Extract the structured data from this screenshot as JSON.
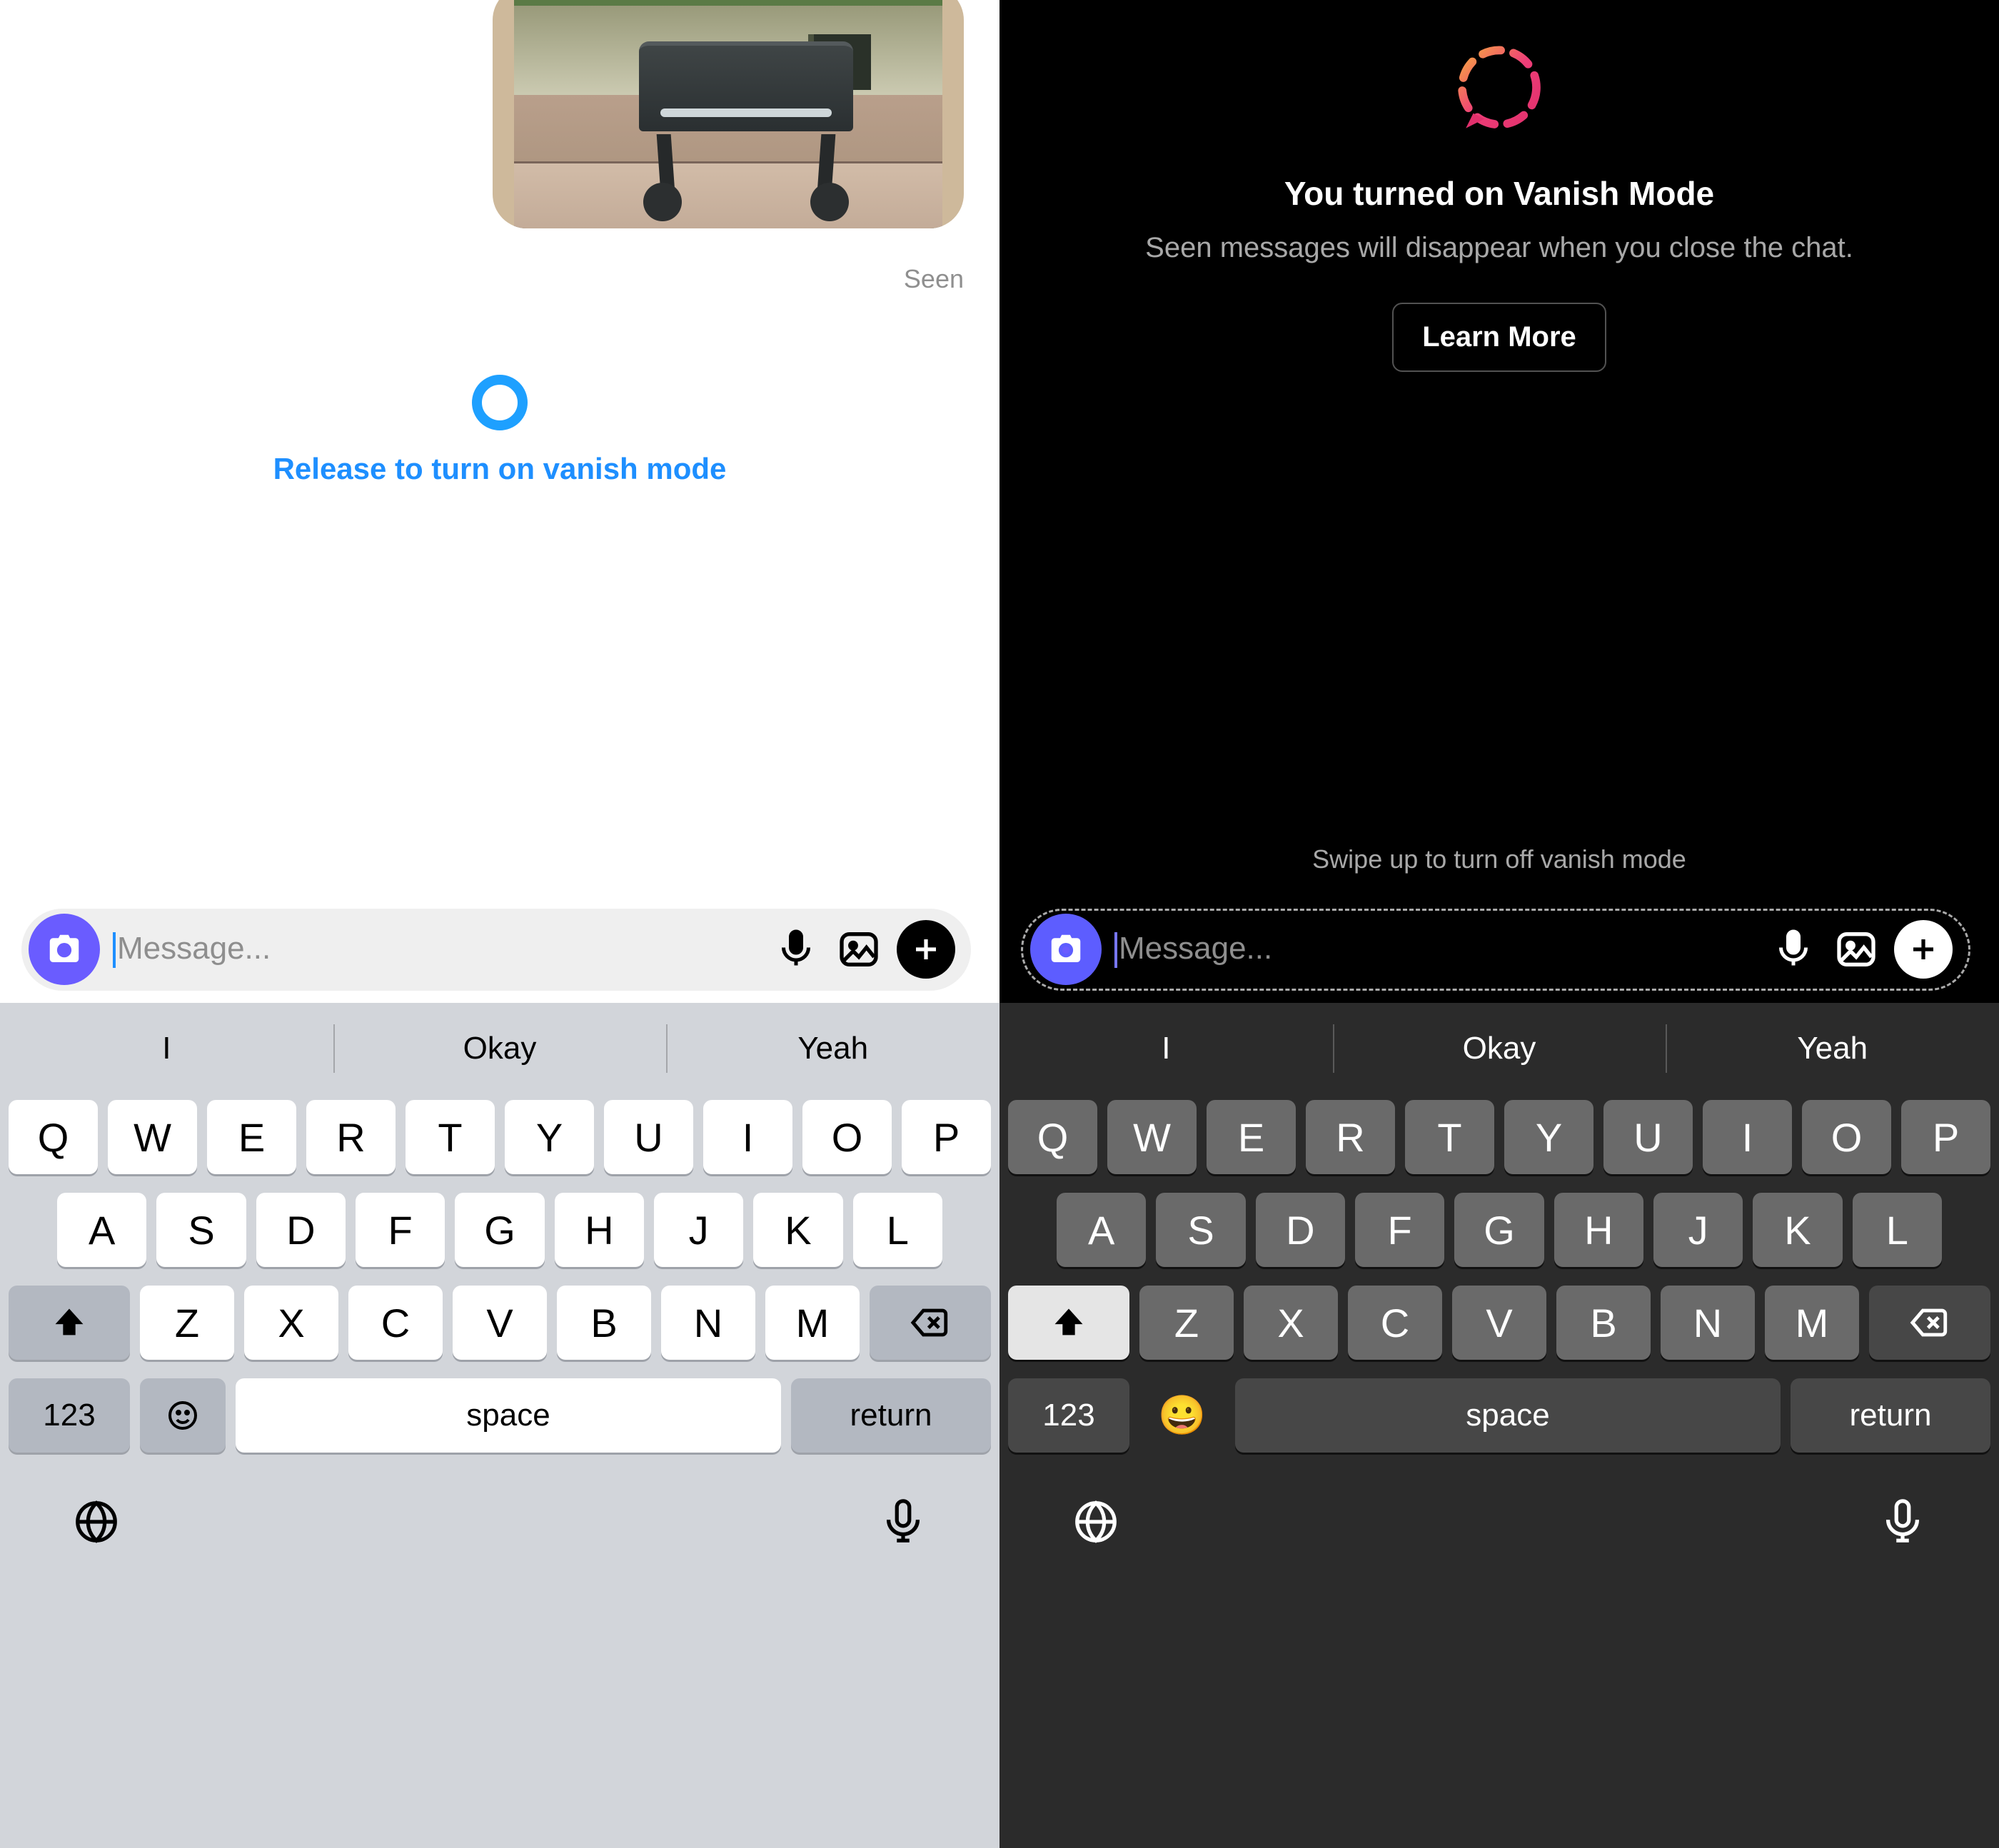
{
  "left": {
    "seen": "Seen",
    "vanish_prompt": "Release to turn on vanish mode",
    "input_placeholder": "Message..."
  },
  "right": {
    "title": "You turned on Vanish Mode",
    "subtitle": "Seen messages will disappear when you close the chat.",
    "learn_more": "Learn More",
    "swipe_off": "Swipe up to turn off vanish mode",
    "input_placeholder": "Message..."
  },
  "keyboard": {
    "suggestions": [
      "I",
      "Okay",
      "Yeah"
    ],
    "row1": [
      "Q",
      "W",
      "E",
      "R",
      "T",
      "Y",
      "U",
      "I",
      "O",
      "P"
    ],
    "row2": [
      "A",
      "S",
      "D",
      "F",
      "G",
      "H",
      "J",
      "K",
      "L"
    ],
    "row3": [
      "Z",
      "X",
      "C",
      "V",
      "B",
      "N",
      "M"
    ],
    "numeric": "123",
    "space": "space",
    "return": "return"
  }
}
